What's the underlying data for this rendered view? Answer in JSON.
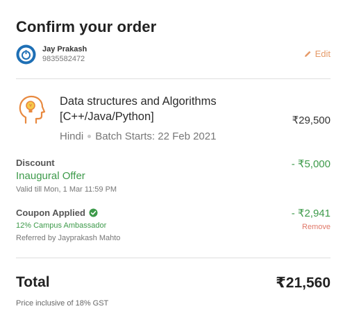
{
  "header": {
    "title": "Confirm your order"
  },
  "user": {
    "name": "Jay Prakash",
    "phone": "9835582472",
    "edit_label": "Edit"
  },
  "course": {
    "title": "Data structures and Algorithms [C++/Java/Python]",
    "language": "Hindi",
    "batch": "Batch Starts: 22 Feb 2021",
    "price": "₹29,500"
  },
  "discount": {
    "label": "Discount",
    "offer_name": "Inaugural Offer",
    "valid_till": "Valid till Mon, 1 Mar 11:59 PM",
    "amount": "- ₹5,000"
  },
  "coupon": {
    "label": "Coupon Applied",
    "name": "12% Campus Ambassador",
    "referred_by": "Referred by Jayprakash Mahto",
    "amount": "- ₹2,941",
    "remove_label": "Remove"
  },
  "total": {
    "label": "Total",
    "amount": "₹21,560",
    "note": "Price inclusive of 18% GST"
  },
  "colors": {
    "accent_orange": "#e59a68",
    "green": "#3d9a4a",
    "remove_red": "#e07868",
    "avatar_blue": "#1e6fb5"
  },
  "icons": [
    "power-avatar-icon",
    "pencil-icon",
    "head-bulb-icon",
    "check-circle-icon"
  ]
}
